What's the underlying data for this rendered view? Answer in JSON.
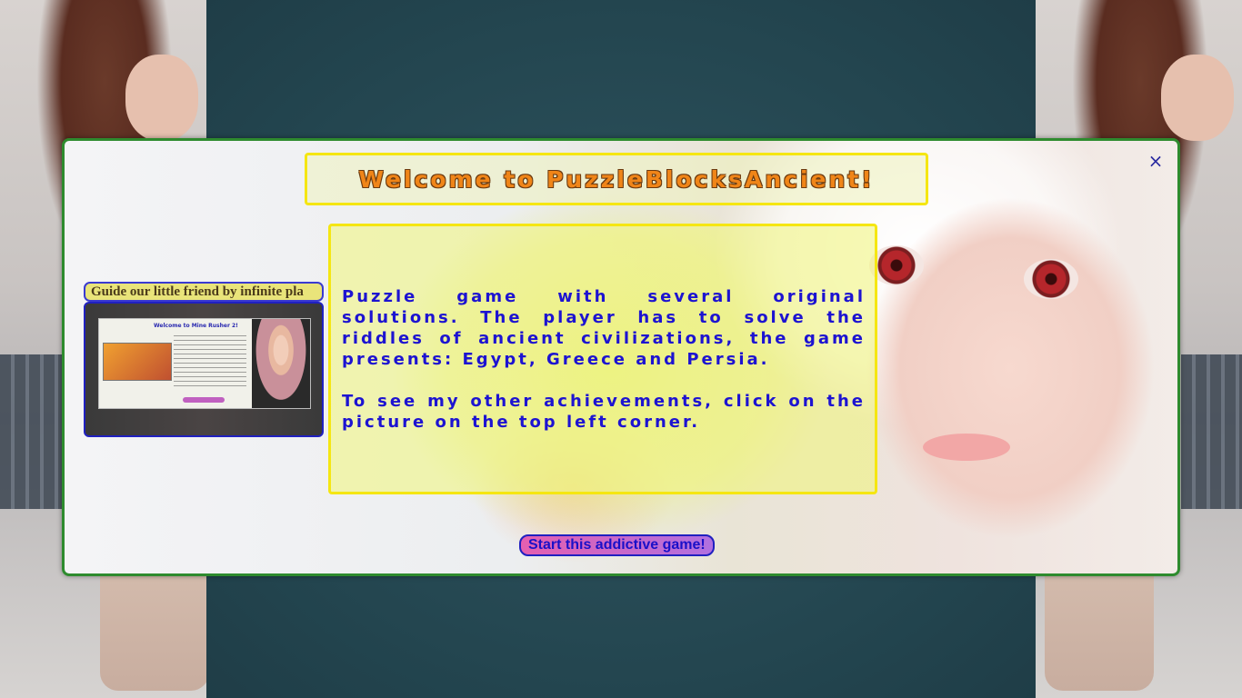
{
  "modal": {
    "title": "Welcome to PuzzleBlocksAncient!",
    "close_label": "×",
    "description_paragraphs": [
      "Puzzle game with several original solutions. The player has to solve the riddles of ancient civilizations, the game presents: Egypt, Greece and Persia.",
      "To see my other achievements, click on the picture on the top left corner."
    ],
    "ticker_text": "Guide our little friend by infinite pla",
    "thumbnail": {
      "title": "Welcome to Mine Rusher 2!"
    },
    "start_button_label": "Start this addictive game!"
  },
  "colors": {
    "modal_border": "#2e8b2e",
    "title_border": "#f5e612",
    "title_text": "#f08518",
    "description_text": "#1d13d1",
    "start_button_gradient": [
      "#e45fb0",
      "#b070e0"
    ]
  }
}
